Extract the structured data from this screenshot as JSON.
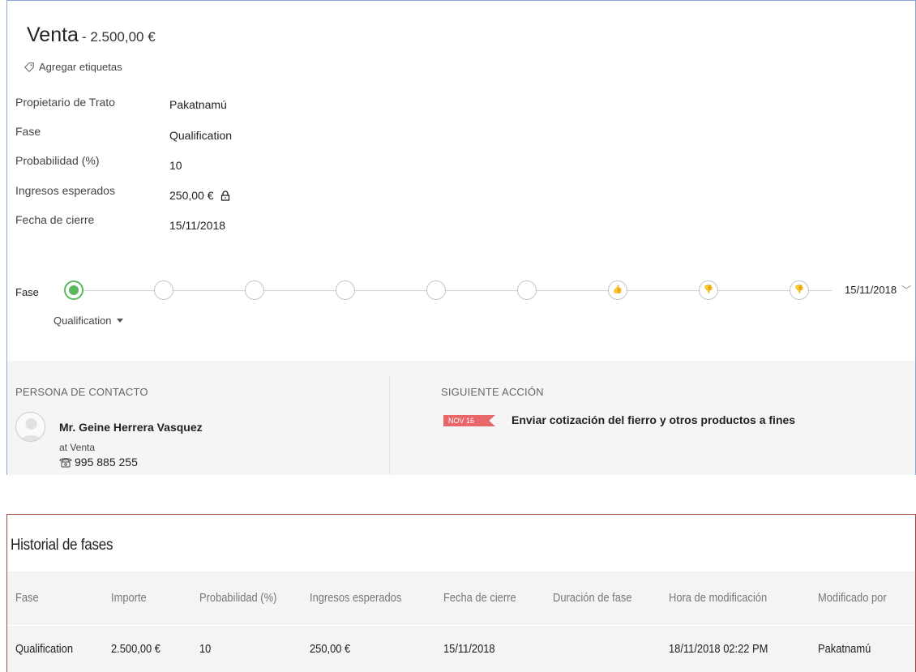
{
  "deal": {
    "title": "Venta",
    "amount": "- 2.500,00 €",
    "add_tags": "Agregar etiquetas",
    "fields": [
      {
        "label": "Propietario de Trato",
        "value": "Pakatnamú"
      },
      {
        "label": "Fase",
        "value": "Qualification"
      },
      {
        "label": "Probabilidad (%)",
        "value": "10"
      },
      {
        "label": "Ingresos esperados",
        "value": "250,00 €"
      },
      {
        "label": "Fecha de cierre",
        "value": "15/11/2018"
      }
    ],
    "stage": {
      "label": "Fase",
      "selected": "Qualification",
      "closing_date": "15/11/2018",
      "active_index": 0,
      "node_count": 9
    }
  },
  "contact": {
    "heading": "PERSONA DE CONTACTO",
    "name": "Mr. Geine Herrera Vasquez",
    "company": "at Venta",
    "phone": "995 885 255"
  },
  "next_action": {
    "heading": "SIGUIENTE ACCIÓN",
    "date_badge": "NOV 16",
    "text": "Enviar cotización del fierro y otros productos a fines"
  },
  "history": {
    "title": "Historial de fases",
    "columns": [
      "Fase",
      "Importe",
      "Probabilidad (%)",
      "Ingresos esperados",
      "Fecha de cierre",
      "Duración de fase",
      "Hora de modificación",
      "Modificado por"
    ],
    "rows": [
      [
        "Qualification",
        "2.500,00 €",
        "10",
        "250,00 €",
        "15/11/2018",
        "",
        "18/11/2018 02:22 PM",
        "Pakatnamú"
      ]
    ]
  },
  "colors": {
    "card_border": "#8aa6d6",
    "history_border": "#a94442",
    "stage_active": "#5cb85c",
    "date_badge": "#e8686a",
    "panel_bg": "#f5f5f5"
  }
}
